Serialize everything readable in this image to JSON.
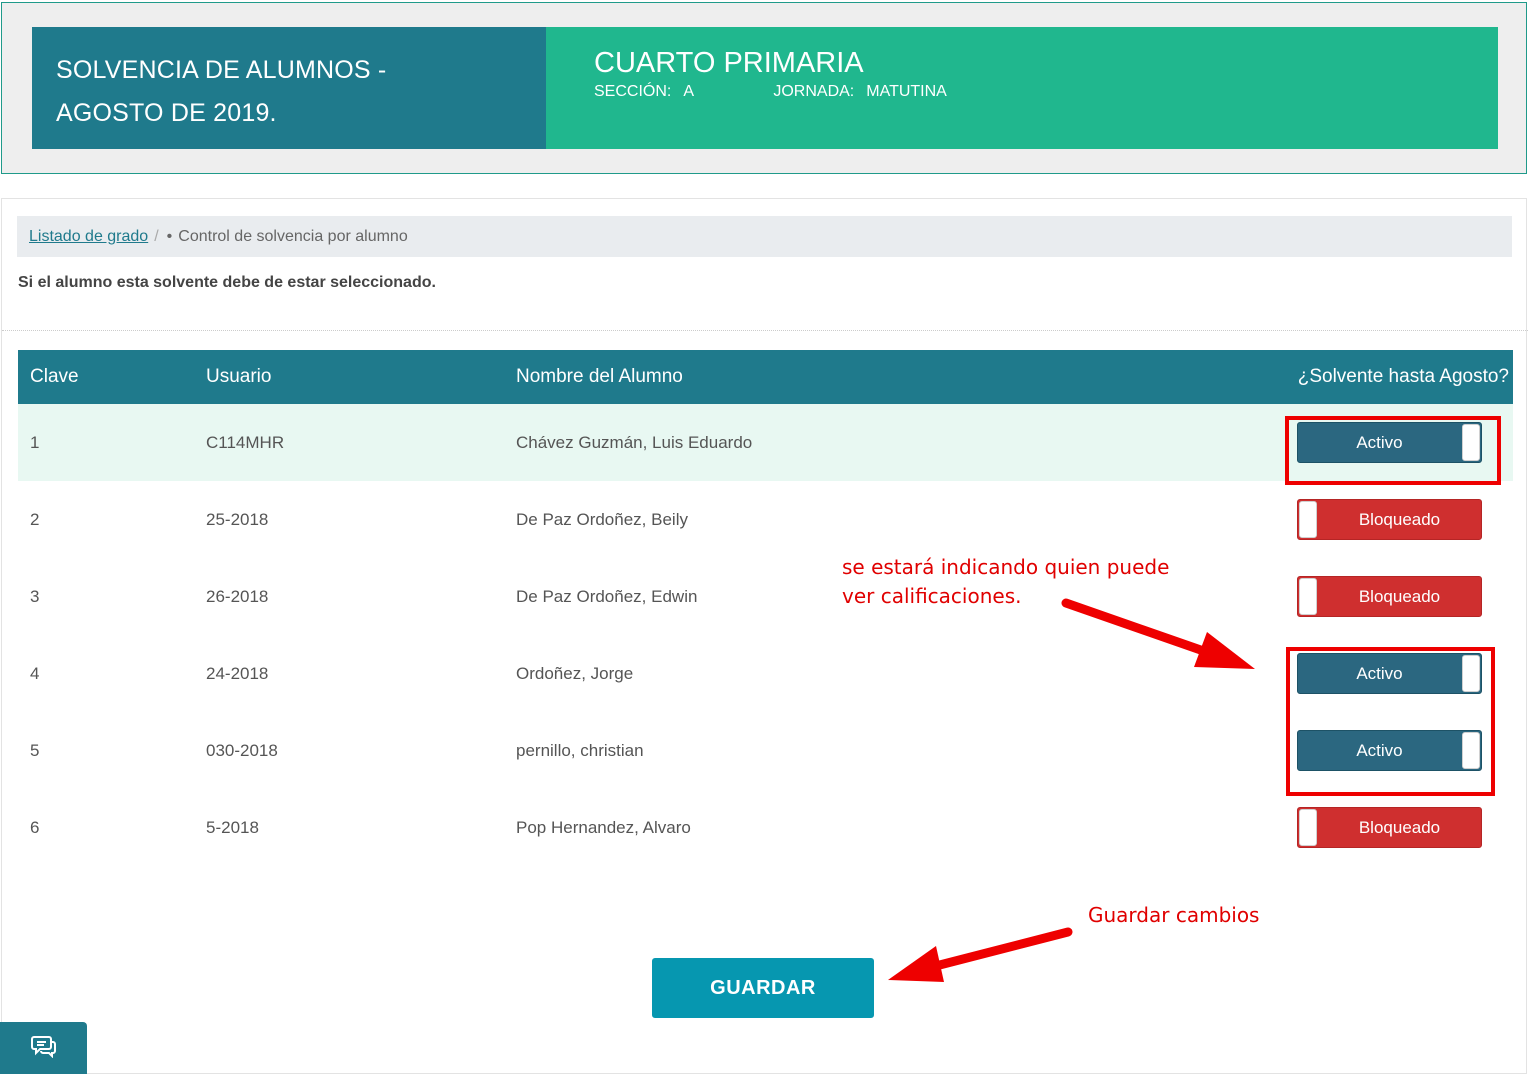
{
  "header": {
    "title_line1": "SOLVENCIA DE ALUMNOS -",
    "title_line2": "AGOSTO DE 2019.",
    "grade": "CUARTO PRIMARIA",
    "section_label": "SECCIÓN:",
    "section_value": "A",
    "shift_label": "JORNADA:",
    "shift_value": "MATUTINA"
  },
  "breadcrumb": {
    "link": "Listado de grado",
    "separator": "/",
    "current": "Control de solvencia por alumno"
  },
  "instruction": "Si el alumno esta solvente debe de estar seleccionado.",
  "table": {
    "headers": [
      "Clave",
      "Usuario",
      "Nombre del Alumno",
      "¿Solvente hasta Agosto?"
    ],
    "rows": [
      {
        "clave": "1",
        "usuario": "C114MHR",
        "nombre": "Chávez Guzmán, Luis Eduardo",
        "estado": "Activo"
      },
      {
        "clave": "2",
        "usuario": "25-2018",
        "nombre": "De Paz Ordoñez, Beily",
        "estado": "Bloqueado"
      },
      {
        "clave": "3",
        "usuario": "26-2018",
        "nombre": "De Paz Ordoñez, Edwin",
        "estado": "Bloqueado"
      },
      {
        "clave": "4",
        "usuario": "24-2018",
        "nombre": "Ordoñez, Jorge",
        "estado": "Activo"
      },
      {
        "clave": "5",
        "usuario": "030-2018",
        "nombre": "pernillo, christian",
        "estado": "Activo"
      },
      {
        "clave": "6",
        "usuario": "5-2018",
        "nombre": "Pop Hernandez, Alvaro",
        "estado": "Bloqueado"
      }
    ]
  },
  "save_button": "GUARDAR",
  "annotations": {
    "note1_line1": "se estará indicando quien puede",
    "note1_line2": "ver calificaciones.",
    "note2": "Guardar cambios",
    "color": "#ee0000"
  },
  "colors": {
    "header_dark": "#1f7a8c",
    "header_green": "#20b78e",
    "toggle_on": "#2b6780",
    "toggle_off": "#cf2f2f",
    "save_button": "#0697b0"
  },
  "icons": {
    "chat": "chat-bubbles-icon"
  }
}
